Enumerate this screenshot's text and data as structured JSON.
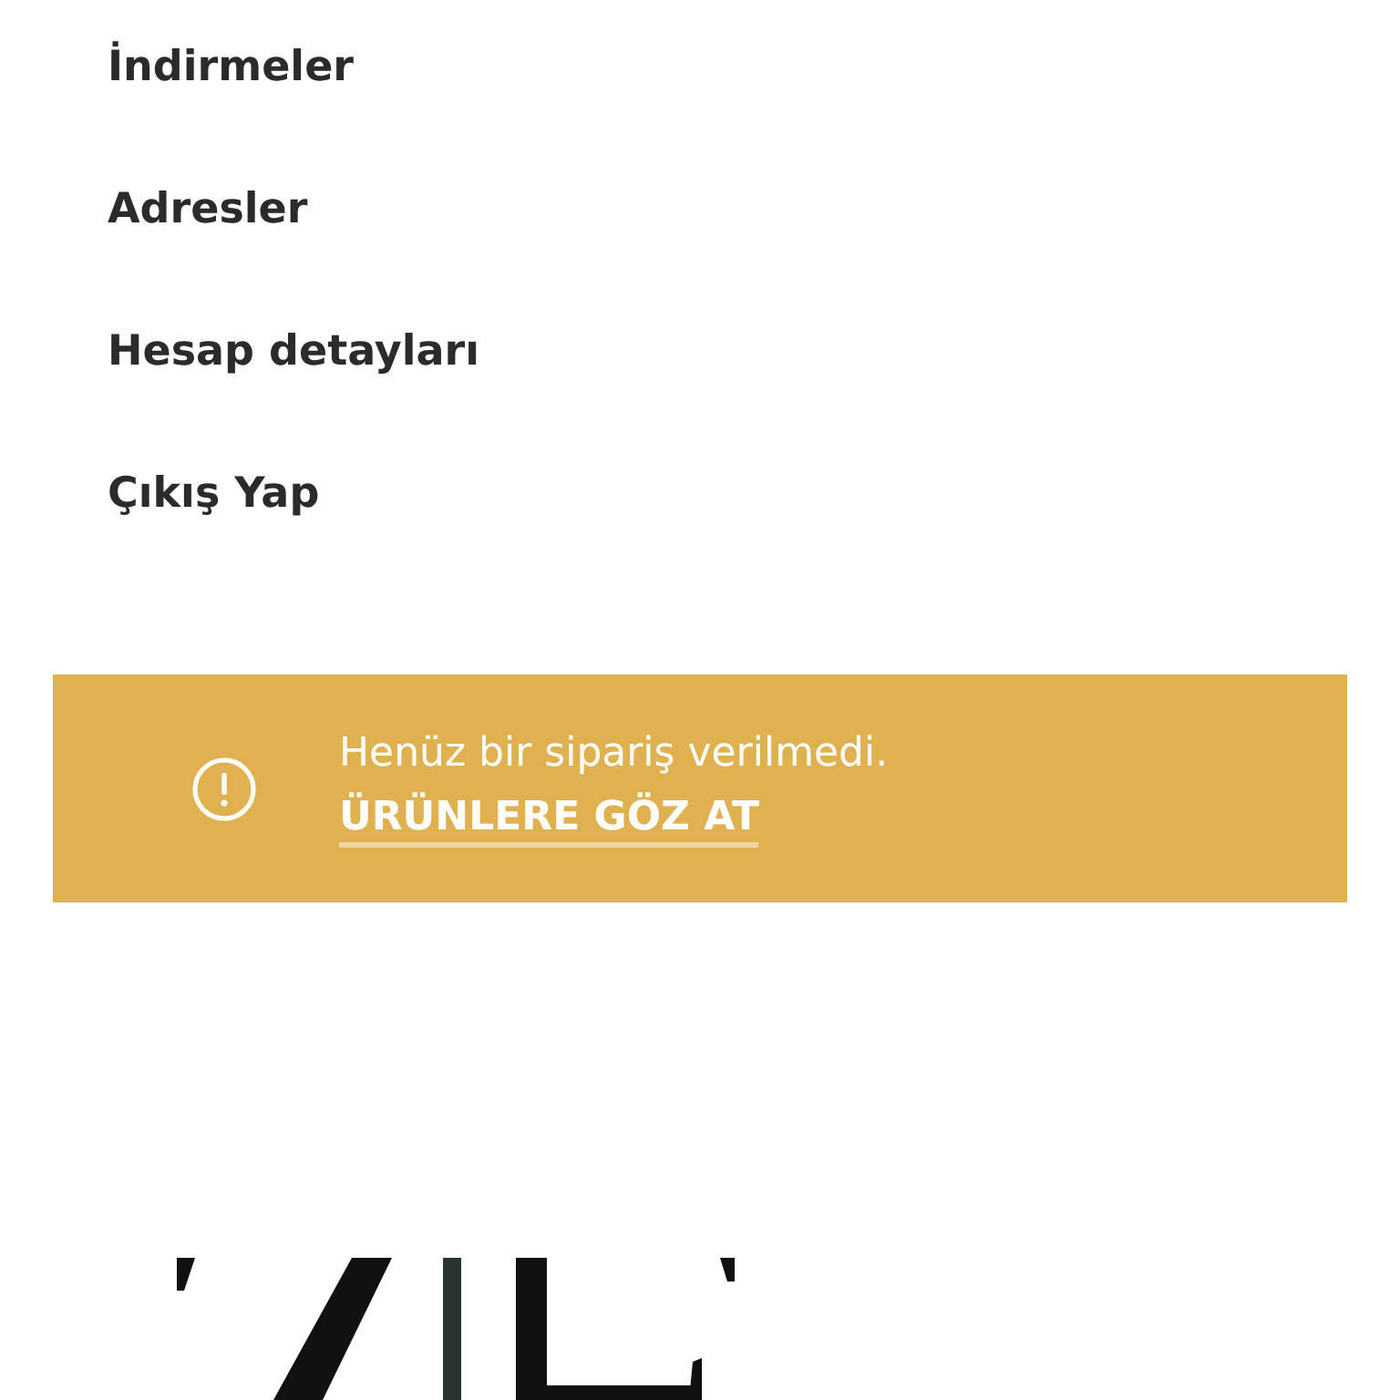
{
  "account_menu": {
    "items": [
      {
        "label": "İndirmeler"
      },
      {
        "label": "Adresler"
      },
      {
        "label": "Hesap detayları"
      },
      {
        "label": "Çıkış Yap"
      }
    ]
  },
  "notice": {
    "message": "Henüz bir sipariş verilmedi.",
    "link": "ÜRÜNLERE GÖZ AT"
  }
}
